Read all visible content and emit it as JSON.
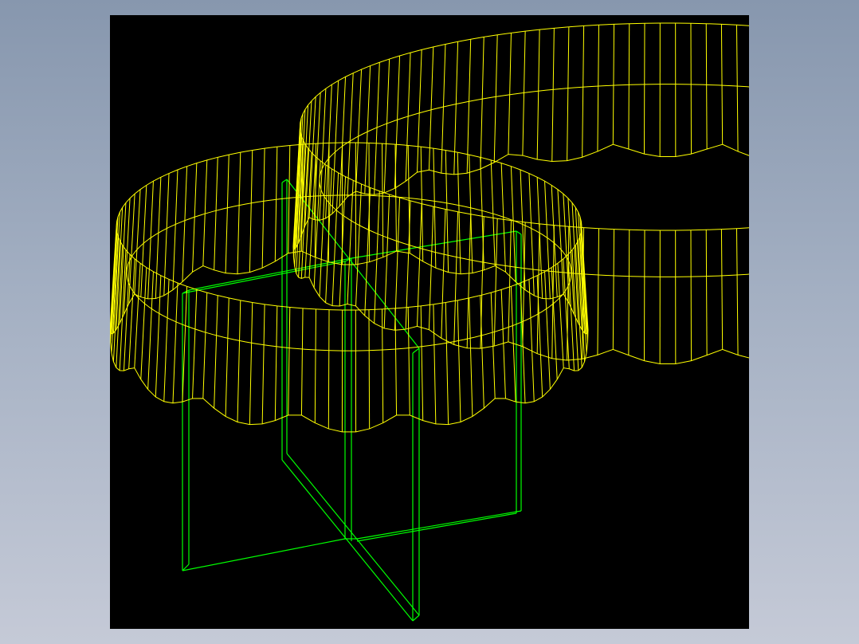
{
  "viewport": {
    "background": "#000000"
  },
  "colors": {
    "gear_wireframe": "#ffff00",
    "frame_wireframe": "#00ff00",
    "window_gradient_top": "#8797ae",
    "window_gradient_bottom": "#c5cad7"
  },
  "model": {
    "gears": [
      {
        "name": "large-gear",
        "teeth": 22,
        "hatch_lines": 150
      },
      {
        "name": "small-gear",
        "teeth": 14,
        "hatch_lines": 110
      }
    ],
    "frame": {
      "name": "cross-frame",
      "plates": 2
    }
  }
}
